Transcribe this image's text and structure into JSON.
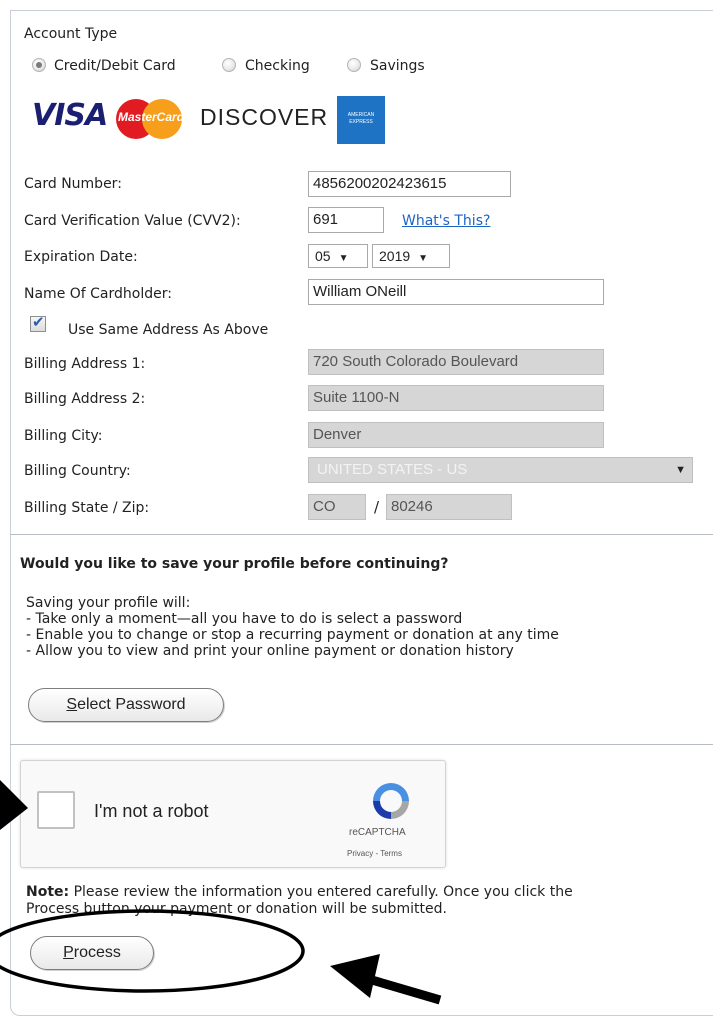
{
  "account_type": {
    "label": "Account Type",
    "options": [
      {
        "label": "Credit/Debit Card",
        "selected": true
      },
      {
        "label": "Checking",
        "selected": false
      },
      {
        "label": "Savings",
        "selected": false
      }
    ]
  },
  "card_logos": {
    "visa": "VISA",
    "mastercard": "MasterCard",
    "discover": "DISCOVER",
    "amex": "AMERICAN EXPRESS"
  },
  "card": {
    "number_label": "Card Number:",
    "number_value": "4856200202423615",
    "cvv_label": "Card Verification Value (CVV2):",
    "cvv_value": "691",
    "cvv_help": "What's This?",
    "exp_label": "Expiration Date:",
    "exp_month": "05",
    "exp_year": "2019",
    "name_label": "Name Of Cardholder:",
    "name_value": "William ONeill"
  },
  "billing": {
    "same_address_label": "Use Same Address As Above",
    "same_address_checked": true,
    "address1_label": "Billing Address 1:",
    "address1_value": "720 South Colorado Boulevard",
    "address2_label": "Billing Address 2:",
    "address2_value": "Suite 1100-N",
    "city_label": "Billing City:",
    "city_value": "Denver",
    "country_label": "Billing Country:",
    "country_value": "UNITED STATES - US",
    "state_zip_label": "Billing State / Zip:",
    "state_value": "CO",
    "zip_sep": "/",
    "zip_value": "80246"
  },
  "profile": {
    "heading": "Would you like to save your profile before continuing?",
    "intro": "Saving your profile will:",
    "bullets": [
      "- Take only a moment—all you have to do is select a password",
      "- Enable you to change or stop a recurring payment or donation at any time",
      "- Allow you to view and print your online payment or donation history"
    ],
    "button_first": "S",
    "button_rest": "elect Password"
  },
  "captcha": {
    "label": "I'm not a robot",
    "brand": "reCAPTCHA",
    "links": "Privacy - Terms"
  },
  "note": {
    "bold": "Note:",
    "text": " Please review the information you entered carefully. Once you click the",
    "text2": "Process button your payment or donation will be submitted."
  },
  "process": {
    "button_first": "P",
    "button_rest": "rocess"
  },
  "colors": {
    "link": "#1d64c4",
    "disabled_field": "#d6d6d6",
    "annotation": "#000000"
  }
}
